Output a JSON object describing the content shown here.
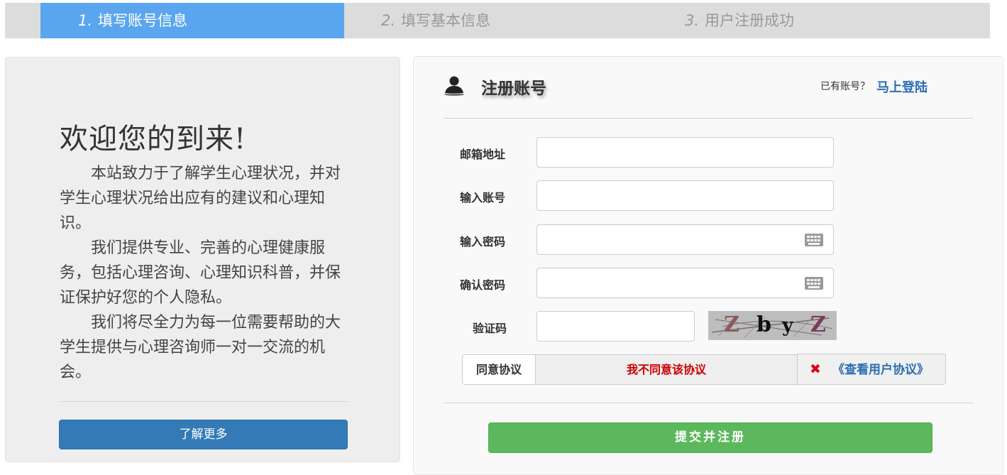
{
  "steps": [
    {
      "num": "1.",
      "label": "填写账号信息"
    },
    {
      "num": "2.",
      "label": "填写基本信息"
    },
    {
      "num": "3.",
      "label": "用户注册成功"
    }
  ],
  "welcome": {
    "title": "欢迎您的到来!",
    "paragraphs": [
      "本站致力于了解学生心理状况，并对学生心理状况给出应有的建议和心理知识。",
      "我们提供专业、完善的心理健康服务，包括心理咨询、心理知识科普，并保证保护好您的个人隐私。",
      "我们将尽全力为每一位需要帮助的大学生提供与心理咨询师一对一交流的机会。"
    ],
    "learn_more": "了解更多"
  },
  "register": {
    "title": "注册账号",
    "has_account": "已有账号？",
    "login_link": "马上登陆",
    "fields": {
      "email": {
        "label": "邮箱地址",
        "value": ""
      },
      "account": {
        "label": "输入账号",
        "value": ""
      },
      "password": {
        "label": "输入密码",
        "value": ""
      },
      "confirm": {
        "label": "确认密码",
        "value": ""
      },
      "captcha": {
        "label": "验证码",
        "value": "",
        "image_text": [
          "Z",
          "b",
          "y",
          "Z"
        ]
      }
    },
    "agreement": {
      "label": "同意协议",
      "status": "我不同意该协议",
      "view_link": "《查看用户协议》"
    },
    "submit": "提交并注册"
  },
  "colors": {
    "active_step": "#5aa6ee",
    "primary": "#337ab7",
    "success": "#5cb85c",
    "danger": "#cc0000",
    "link": "#2a6db3"
  },
  "icons": {
    "user": "user-icon",
    "keyboard": "keyboard-icon",
    "close": "close-icon"
  }
}
